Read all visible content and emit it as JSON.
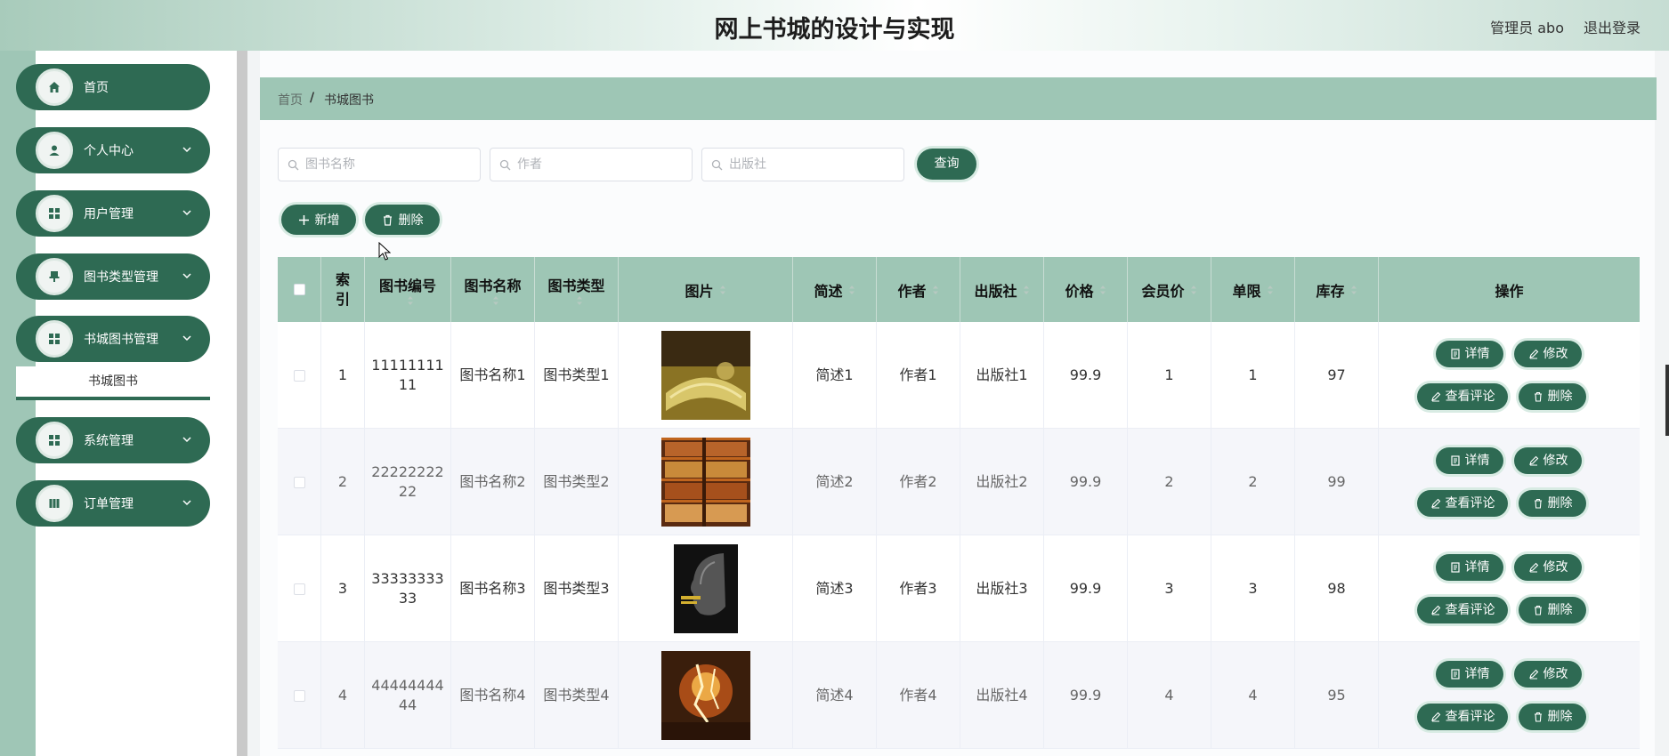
{
  "header": {
    "title": "网上书城的设计与实现",
    "admin_label": "管理员 abo",
    "logout_label": "退出登录"
  },
  "sidebar": {
    "items": [
      {
        "label": "首页",
        "icon": "home-icon"
      },
      {
        "label": "个人中心",
        "icon": "user-icon"
      },
      {
        "label": "用户管理",
        "icon": "grid-icon"
      },
      {
        "label": "图书类型管理",
        "icon": "pin-icon"
      },
      {
        "label": "书城图书管理",
        "icon": "grid-icon"
      },
      {
        "label": "系统管理",
        "icon": "grid-icon"
      },
      {
        "label": "订单管理",
        "icon": "book-icon"
      }
    ],
    "submenu_active": "书城图书"
  },
  "breadcrumb": {
    "home": "首页",
    "separator": "/",
    "current": "书城图书"
  },
  "search": {
    "name_placeholder": "图书名称",
    "author_placeholder": "作者",
    "publisher_placeholder": "出版社",
    "query_label": "查询"
  },
  "actions": {
    "add_label": "新增",
    "delete_label": "删除"
  },
  "table": {
    "headers": {
      "index": "索引",
      "code": "图书编号",
      "name": "图书名称",
      "type": "图书类型",
      "image": "图片",
      "desc": "简述",
      "author": "作者",
      "publisher": "出版社",
      "price": "价格",
      "member_price": "会员价",
      "limit": "单限",
      "stock": "库存",
      "ops": "操作"
    },
    "op_labels": {
      "detail": "详情",
      "edit": "修改",
      "comments": "查看评论",
      "delete": "删除"
    },
    "rows": [
      {
        "index": "1",
        "code_a": "11111111",
        "code_b": "11",
        "name": "图书名称1",
        "type": "图书类型1",
        "desc": "简述1",
        "author": "作者1",
        "publisher": "出版社1",
        "price": "99.9",
        "member_price": "1",
        "limit": "1",
        "stock": "97"
      },
      {
        "index": "2",
        "code_a": "22222222",
        "code_b": "22",
        "name": "图书名称2",
        "type": "图书类型2",
        "desc": "简述2",
        "author": "作者2",
        "publisher": "出版社2",
        "price": "99.9",
        "member_price": "2",
        "limit": "2",
        "stock": "99"
      },
      {
        "index": "3",
        "code_a": "33333333",
        "code_b": "33",
        "name": "图书名称3",
        "type": "图书类型3",
        "desc": "简述3",
        "author": "作者3",
        "publisher": "出版社3",
        "price": "99.9",
        "member_price": "3",
        "limit": "3",
        "stock": "98"
      },
      {
        "index": "4",
        "code_a": "44444444",
        "code_b": "44",
        "name": "图书名称4",
        "type": "图书类型4",
        "desc": "简述4",
        "author": "作者4",
        "publisher": "出版社4",
        "price": "99.9",
        "member_price": "4",
        "limit": "4",
        "stock": "95"
      }
    ]
  },
  "colors": {
    "accent": "#2e6a53",
    "header_row": "#9ec6b5"
  }
}
